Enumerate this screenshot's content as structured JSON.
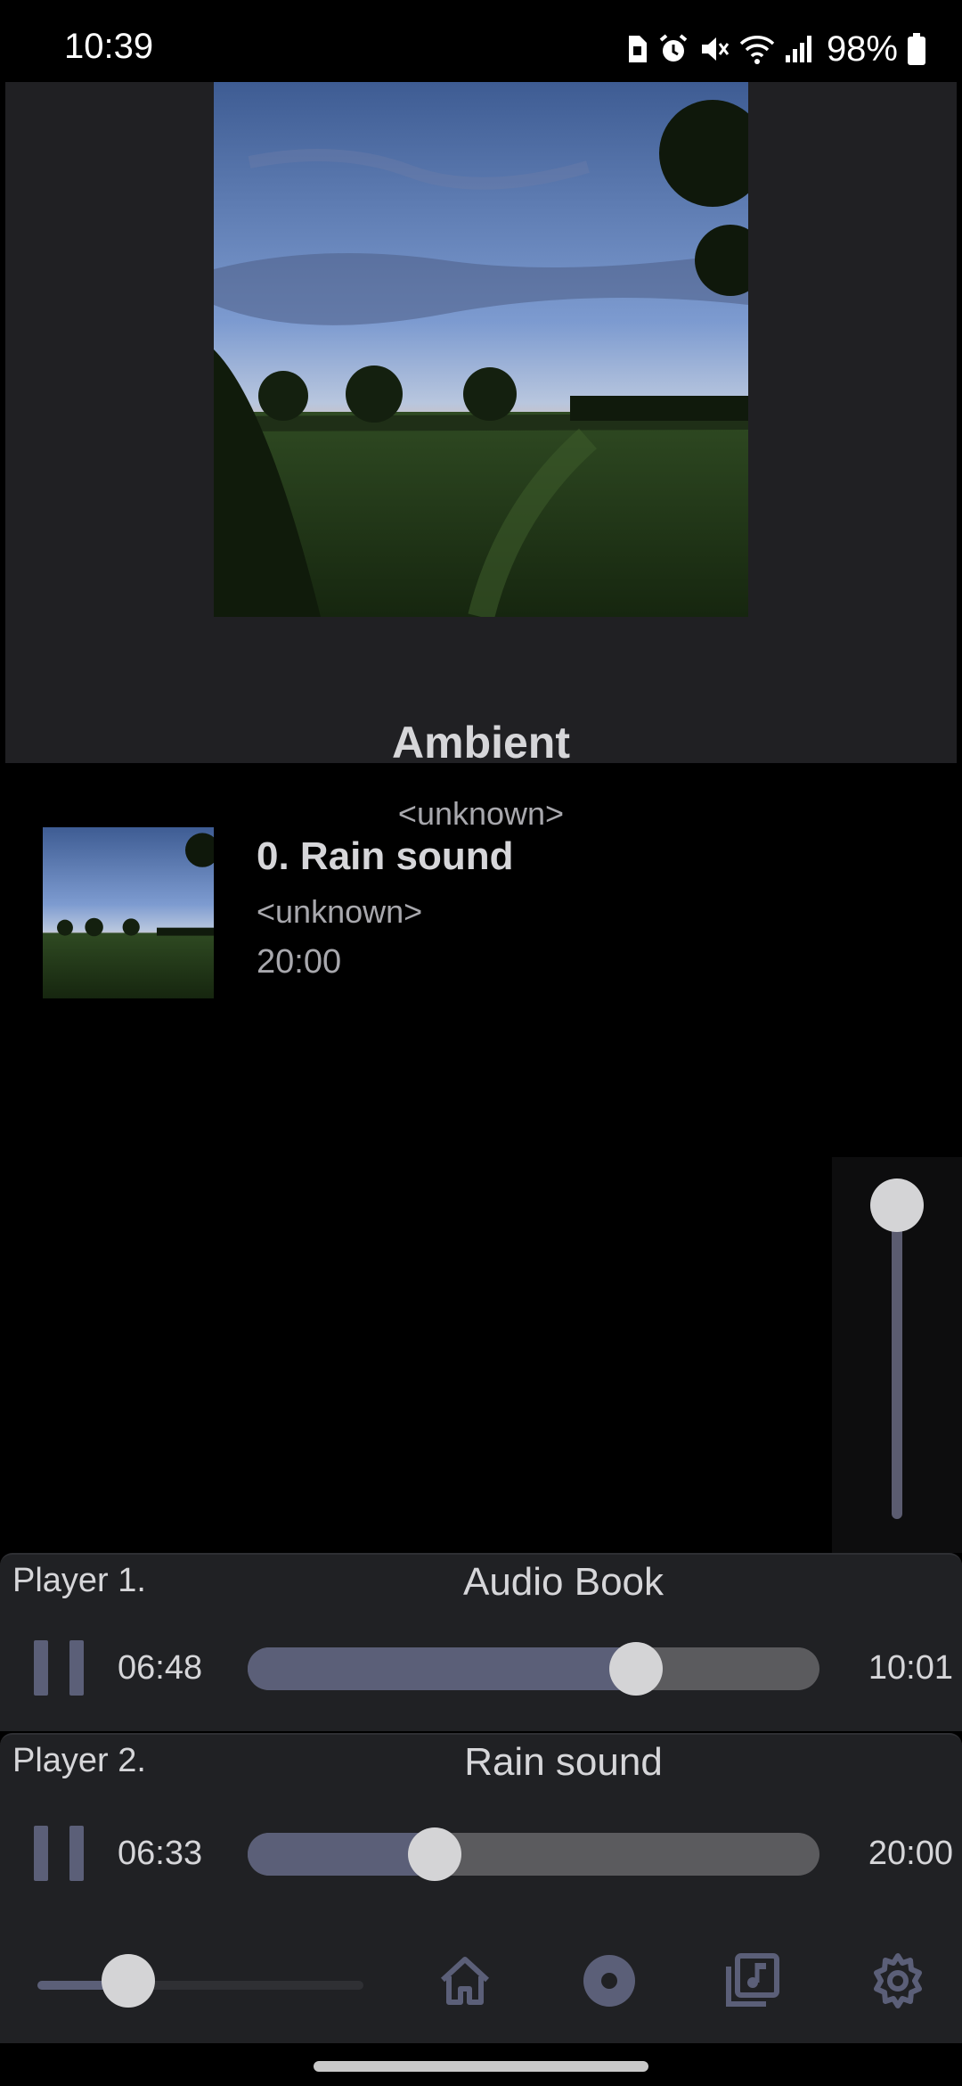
{
  "status_bar": {
    "time": "10:39",
    "battery": "98%",
    "icons": [
      "sim-icon",
      "alarm-icon",
      "mute-icon",
      "wifi-icon",
      "signal-icon",
      "battery-icon"
    ]
  },
  "album": {
    "title": "Ambient",
    "artist": "<unknown>",
    "art_icon": "landscape-sunset-image"
  },
  "track_list": [
    {
      "title": "0. Rain sound",
      "artist": "<unknown>",
      "duration": "20:00"
    }
  ],
  "volume_slider": {
    "value": 1.0
  },
  "players": [
    {
      "label": "Player 1.",
      "track": "Audio Book",
      "elapsed": "06:48",
      "total": "10:01",
      "progress": 0.679
    },
    {
      "label": "Player 2.",
      "track": "Rain sound",
      "elapsed": "06:33",
      "total": "20:00",
      "progress": 0.3275
    }
  ],
  "bottom_nav": {
    "master_level": 0.28,
    "items": [
      "home-icon",
      "disc-icon",
      "music-library-icon",
      "gear-icon"
    ]
  },
  "colors": {
    "background": "#000000",
    "panel": "#202124",
    "accent": "#5b5f78",
    "thumb": "#d4d4d6",
    "text": "#d6d6d9",
    "muted_text": "#a8a8ad"
  }
}
